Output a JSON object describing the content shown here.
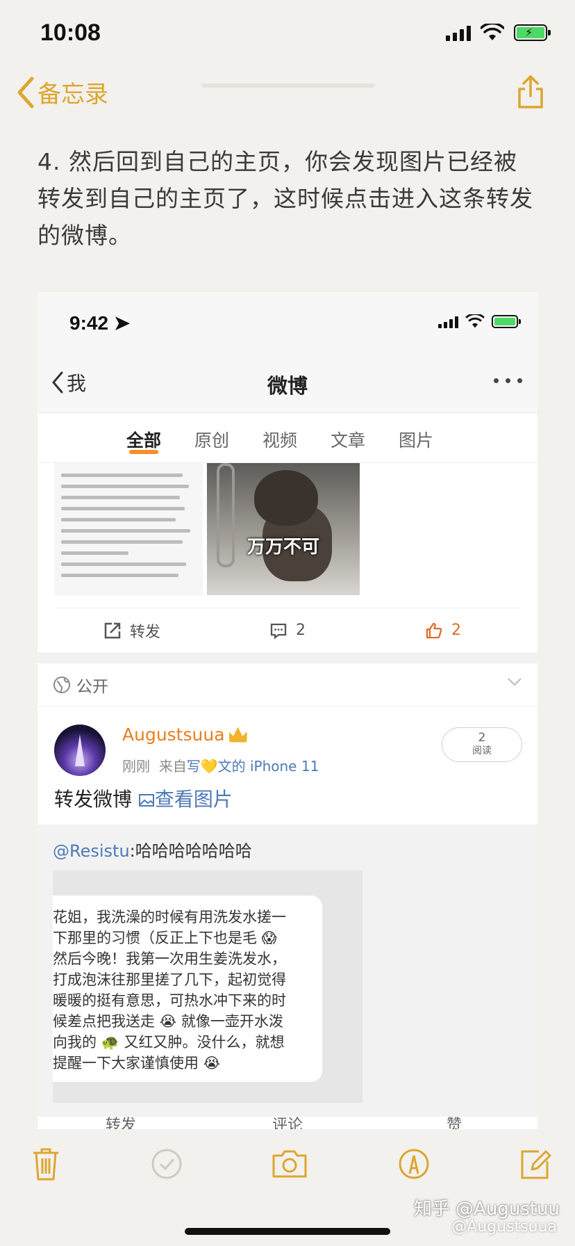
{
  "status_bar": {
    "time": "10:08"
  },
  "nav": {
    "back_label": "备忘录"
  },
  "note": {
    "text": "4. 然后回到自己的主页，你会发现图片已经被转发到自己的主页了，这时候点击进入这条转发的微博。"
  },
  "weibo": {
    "status_time": "9:42",
    "back_label": "我",
    "title": "微博",
    "tabs": [
      "全部",
      "原创",
      "视频",
      "文章",
      "图片"
    ],
    "image_caption": "万万不可",
    "actions": {
      "repost": "转发",
      "comments": "2",
      "likes": "2"
    },
    "privacy": "公开",
    "post": {
      "username": "Augustsuua",
      "time": "刚刚",
      "source_prefix": "来自",
      "source_a": "写",
      "source_b": "文的 iPhone 11",
      "read_count": "2",
      "read_label": "阅读",
      "text": "转发微博",
      "view_image": "查看图片"
    },
    "repost": {
      "mention": "@Resistu",
      "text": ":哈哈哈哈哈哈哈",
      "bubble": "花姐，我洗澡的时候有用洗发水搓一\n下那里的习惯（反正上下也是毛 😱\n然后今晚！我第一次用生姜洗发水，\n打成泡沫往那里搓了几下，起初觉得\n暖暖的挺有意思，可热水冲下来的时\n候差点把我送走 😭 就像一壶开水泼\n向我的 🐢 又红又肿。没什么，就想\n提醒一下大家谨慎使用 😭"
    },
    "bottom_actions": [
      "转发",
      "评论",
      "赞"
    ]
  },
  "watermark": {
    "line1": "知乎 @Augustuu",
    "line2": "@Augustsuua"
  },
  "colors": {
    "accent": "#dca62f",
    "weibo_orange": "#e97d1e",
    "link_blue": "#4d79b6"
  }
}
